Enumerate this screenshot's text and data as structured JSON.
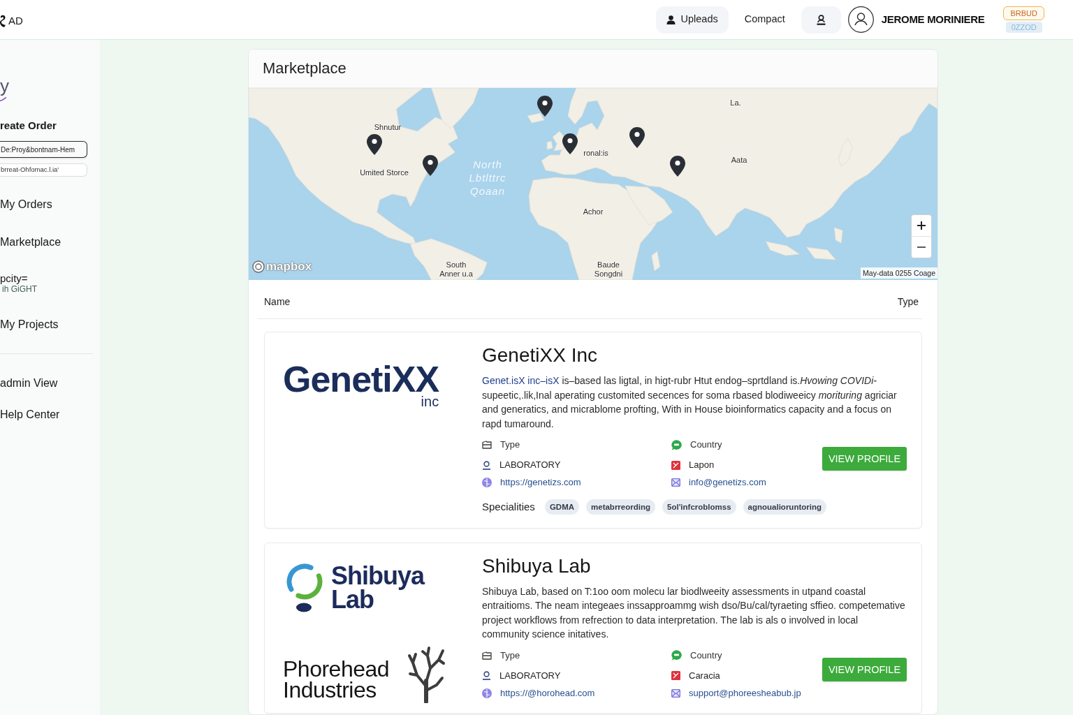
{
  "topbar": {
    "brand": "AD",
    "actions": [
      {
        "kind": "button",
        "label": "Upleads"
      },
      {
        "kind": "link",
        "label": "Compact"
      },
      {
        "kind": "icon"
      }
    ],
    "user": {
      "name": "JEROME MORINIERE"
    },
    "badges": [
      {
        "kind": "outline",
        "text": "BRBUD"
      },
      {
        "kind": "soft",
        "text": "0ZZOD"
      }
    ]
  },
  "sidebar": {
    "logo": "y",
    "create_order": {
      "label": "reate Order",
      "options": [
        {
          "label": "De:Proy&bontnam-Hem",
          "selected": true
        },
        {
          "label": "brreat-Ohfomac.l.ia'",
          "selected": false
        }
      ]
    },
    "sections": [
      {
        "items": [
          {
            "label": "My Orders"
          },
          {
            "label": "Marketplace"
          },
          {
            "label": "pcity=",
            "sublabel": "ih GiGHT"
          },
          {
            "label": "My Projects"
          }
        ]
      },
      {
        "items": [
          {
            "label": "admin View"
          },
          {
            "label": "Help Center"
          }
        ]
      }
    ]
  },
  "panel": {
    "title": "Marketplace",
    "map": {
      "labels": [
        {
          "kind": "place",
          "lines": [
            "Shnutur"
          ]
        },
        {
          "kind": "place",
          "lines": [
            "Umited Storce"
          ]
        },
        {
          "kind": "ocean",
          "lines": [
            "North",
            "Lbtlttrc",
            "Qoaan"
          ]
        },
        {
          "kind": "place",
          "lines": [
            "ronal:is"
          ]
        },
        {
          "kind": "place",
          "lines": [
            "La."
          ]
        },
        {
          "kind": "place",
          "lines": [
            "Aata"
          ]
        },
        {
          "kind": "place",
          "lines": [
            "Achor"
          ]
        },
        {
          "kind": "place",
          "lines": [
            "South",
            "Anner u.a"
          ]
        },
        {
          "kind": "place",
          "lines": [
            "Baude",
            "Songdni"
          ]
        }
      ],
      "logo": "mapbox",
      "attribution": "May-data 0255 Coage"
    },
    "columns": [
      "Name",
      "Type"
    ],
    "companies": [
      {
        "name": "GenetiXX Inc",
        "logos": [
          {
            "kind": "wordmark",
            "lines": [
              "GenetiXX",
              "inc"
            ]
          }
        ],
        "description": [
          {
            "kind": "link",
            "text": "Genet.isX inc–isX"
          },
          {
            "kind": "plain",
            "text": " is–based las ligtal, in higt-rubr Htut endog–sprtdland is."
          },
          {
            "kind": "italic",
            "text": "Hvowing COVIDi-"
          },
          {
            "kind": "plain",
            "text": "supeetic,.lik,Inal aperating customited secences for soma rbased blodiweeicy "
          },
          {
            "kind": "italic",
            "text": "morituring"
          },
          {
            "kind": "plain",
            "text": " agriciar and generatics, and micrablome profting, With in House bioinformatics capacity and a focus on rapd tumaround."
          }
        ],
        "type_label": "Type",
        "type": "LABORATORY",
        "url": "https://genetizs.com",
        "country_label": "Country",
        "country": "Lapon",
        "email": "info@genetizs.com",
        "button": "VIEW PROFILE",
        "specialities_label": "Specialities",
        "specialities": [
          "GDMA",
          "metabrreording",
          "5ol'infcroblomss",
          "agnoualioruntoring"
        ]
      },
      {
        "name": "Shibuya Lab",
        "logos": [
          {
            "kind": "ring",
            "lines": [
              "Shibuya",
              "Lab"
            ]
          },
          {
            "kind": "branch",
            "lines": [
              "Phorehead",
              "Industries"
            ]
          }
        ],
        "description": [
          {
            "kind": "plain",
            "text": "Shibuya Lab, based on T:1oo oom molecu lar biodlweeity assessments in utpand coastal entraitioms. The neam integeaes inssapproammg wish dso/Bu/cal/tyraeting sffieo. competemative project workflows from refrection to data interpretation. The lab is als o involved in local community science initatives."
          }
        ],
        "type_label": "Type",
        "type": "LABORATORY",
        "url": "https://@horohead.com",
        "country_label": "Country",
        "country": "Caracia",
        "email": "support@phoreesheabub.jp",
        "button": "VIEW PROFILE"
      }
    ]
  }
}
